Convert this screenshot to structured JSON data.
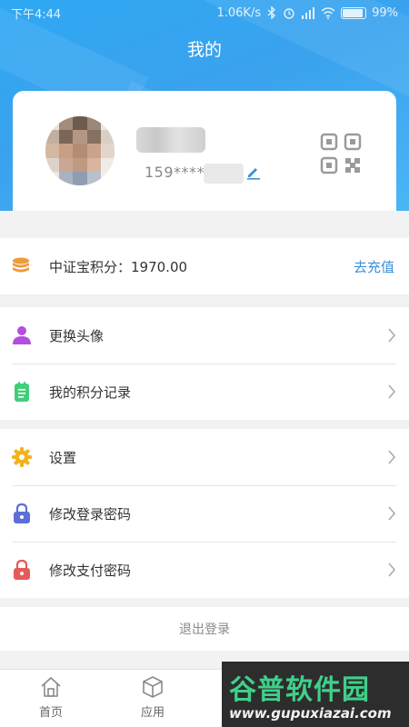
{
  "status_bar": {
    "time": "下午4:44",
    "network_speed": "1.06K/s",
    "battery": "99%"
  },
  "header": {
    "title": "我的"
  },
  "profile": {
    "phone": "159****"
  },
  "points": {
    "label": "中证宝积分：1970.00",
    "action": "去充值"
  },
  "menu_group_1": [
    {
      "label": "更换头像",
      "icon": "user-icon",
      "color": "#b44ee0"
    },
    {
      "label": "我的积分记录",
      "icon": "notepad-icon",
      "color": "#3ecf7a"
    }
  ],
  "menu_group_2": [
    {
      "label": "设置",
      "icon": "gear-icon",
      "color": "#f2b21d"
    },
    {
      "label": "修改登录密码",
      "icon": "lock-icon",
      "color": "#5d6fd6"
    },
    {
      "label": "修改支付密码",
      "icon": "lock-icon",
      "color": "#e75a5a"
    }
  ],
  "logout": {
    "label": "退出登录"
  },
  "tabbar": [
    {
      "label": "首页",
      "icon": "home-icon"
    },
    {
      "label": "应用",
      "icon": "cube-icon"
    }
  ],
  "watermark": {
    "main": "谷普软件园",
    "sub": "www.gupuxiazai.com"
  },
  "colors": {
    "header_blue": "#3aa2ee",
    "link_blue": "#3a8fd9",
    "coin_orange": "#ef9a3a"
  }
}
